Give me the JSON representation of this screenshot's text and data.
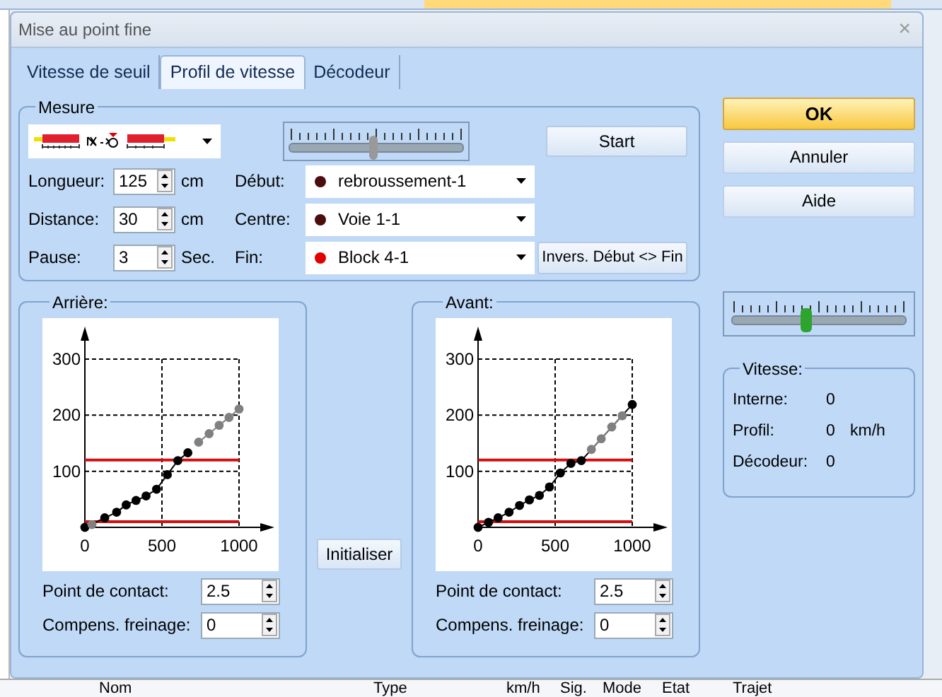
{
  "background": {
    "columns": [
      "Nom",
      "Type",
      "km/h",
      "Sig.",
      "Mode",
      "Etat",
      "Trajet"
    ]
  },
  "window": {
    "title": "Mise au point fine",
    "close": "×"
  },
  "tabs": [
    {
      "label": "Vitesse de seuil",
      "selected": false
    },
    {
      "label": "Profil de vitesse",
      "selected": true
    },
    {
      "label": "Décodeur",
      "selected": false
    }
  ],
  "mesure": {
    "title": "Mesure",
    "slider": {
      "level": 0.48
    },
    "start": "Start",
    "fields": [
      {
        "label": "Longueur:",
        "value": "125",
        "unit": "cm"
      },
      {
        "label": "Distance:",
        "value": "30",
        "unit": "cm"
      },
      {
        "label": "Pause:",
        "value": "3",
        "unit": "Sec."
      }
    ],
    "points": [
      {
        "label": "Début:",
        "value": "rebroussement-1",
        "color": "#4a0c0c"
      },
      {
        "label": "Centre:",
        "value": "Voie 1-1",
        "color": "#4a0c0c"
      },
      {
        "label": "Fin:",
        "value": "Block 4-1",
        "color": "#e00000"
      }
    ],
    "swap": "Invers. Début <> Fin"
  },
  "profiles": [
    {
      "title": "Arrière:",
      "chart_data": {
        "type": "line",
        "xlim": [
          0,
          1000
        ],
        "ylim": [
          0,
          300
        ],
        "xticks": [
          0,
          500,
          1000
        ],
        "yticks": [
          100,
          200,
          300
        ],
        "grid": true,
        "series": [
          {
            "color": "#000000",
            "marker": "circle",
            "x": [
              0,
              129,
              206,
              268,
              332,
              397,
              465,
              535,
              603,
              668
            ],
            "values": [
              0,
              17,
              27,
              40,
              48,
              56,
              68,
              94,
              119,
              133
            ]
          },
          {
            "color": "#808080",
            "marker": "circle",
            "x": [
              46
            ],
            "values": [
              5
            ]
          },
          {
            "color": "#808080",
            "marker": "circle",
            "x": [
              738,
              806,
              871,
              935,
              1000
            ],
            "values": [
              152,
              167,
              182,
              196,
              211
            ]
          }
        ],
        "ref_lines": [
          {
            "axis": "y",
            "value": 120,
            "color": "#d01010"
          },
          {
            "axis": "y",
            "value": 10,
            "color": "#d01010"
          }
        ]
      },
      "fields": [
        {
          "label": "Point de contact:",
          "value": "2.5"
        },
        {
          "label": "Compens. freinage:",
          "value": "0"
        }
      ]
    },
    {
      "title": "Avant:",
      "chart_data": {
        "type": "line",
        "xlim": [
          0,
          1000
        ],
        "ylim": [
          0,
          300
        ],
        "xticks": [
          0,
          500,
          1000
        ],
        "yticks": [
          100,
          200,
          300
        ],
        "grid": true,
        "series": [
          {
            "color": "#000000",
            "marker": "circle",
            "x": [
              0,
              68,
              130,
              201,
              269,
              333,
              398,
              463,
              534,
              602,
              670,
              1000
            ],
            "values": [
              0,
              9,
              17,
              27,
              39,
              49,
              57,
              72,
              97,
              114,
              119,
              219
            ]
          },
          {
            "color": "#808080",
            "marker": "circle",
            "x": [
              735,
              799,
              867,
              935
            ],
            "values": [
              139,
              158,
              179,
              199
            ]
          }
        ],
        "ref_lines": [
          {
            "axis": "y",
            "value": 120,
            "color": "#d01010"
          },
          {
            "axis": "y",
            "value": 10,
            "color": "#d01010"
          }
        ]
      },
      "fields": [
        {
          "label": "Point de contact:",
          "value": "2.5"
        },
        {
          "label": "Compens. freinage:",
          "value": "0"
        }
      ]
    }
  ],
  "reset": "Initialiser",
  "buttons": [
    {
      "label": "OK",
      "kind": "default"
    },
    {
      "label": "Annuler",
      "kind": "normal"
    },
    {
      "label": "Aide",
      "kind": "normal"
    }
  ],
  "speed_slider": {
    "level": 0.43
  },
  "vitesse": {
    "title": "Vitesse:",
    "rows": [
      {
        "label": "Interne:",
        "value": "0"
      },
      {
        "label": "Profil:",
        "value": "0",
        "unit": "km/h"
      },
      {
        "label": "Décodeur:",
        "value": "0"
      }
    ]
  }
}
